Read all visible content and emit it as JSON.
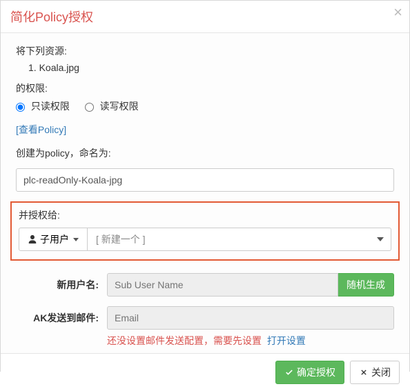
{
  "header": {
    "title": "简化Policy授权"
  },
  "body": {
    "resources_label": "将下列资源:",
    "resources": [
      {
        "index": "1.",
        "name": "Koala.jpg"
      }
    ],
    "permissions_label": "的权限:",
    "perm_readonly_label": "只读权限",
    "perm_readwrite_label": "读写权限",
    "perm_selected": "readonly",
    "view_policy_link": "[查看Policy]",
    "policy_name_label": "创建为policy，命名为:",
    "policy_name_value": "plc-readOnly-Koala-jpg",
    "grant_to_label": "并授权给:",
    "grantee_type_label": "子用户",
    "grantee_select_placeholder": "[ 新建一个 ]",
    "new_user": {
      "label": "新用户名:",
      "placeholder": "Sub User Name",
      "random_btn": "随机生成"
    },
    "ak_email": {
      "label": "AK发送到邮件:",
      "placeholder": "Email",
      "warn": "还没设置邮件发送配置，需要先设置",
      "settings_link": "打开设置"
    }
  },
  "footer": {
    "confirm": "确定授权",
    "close": "关闭"
  }
}
